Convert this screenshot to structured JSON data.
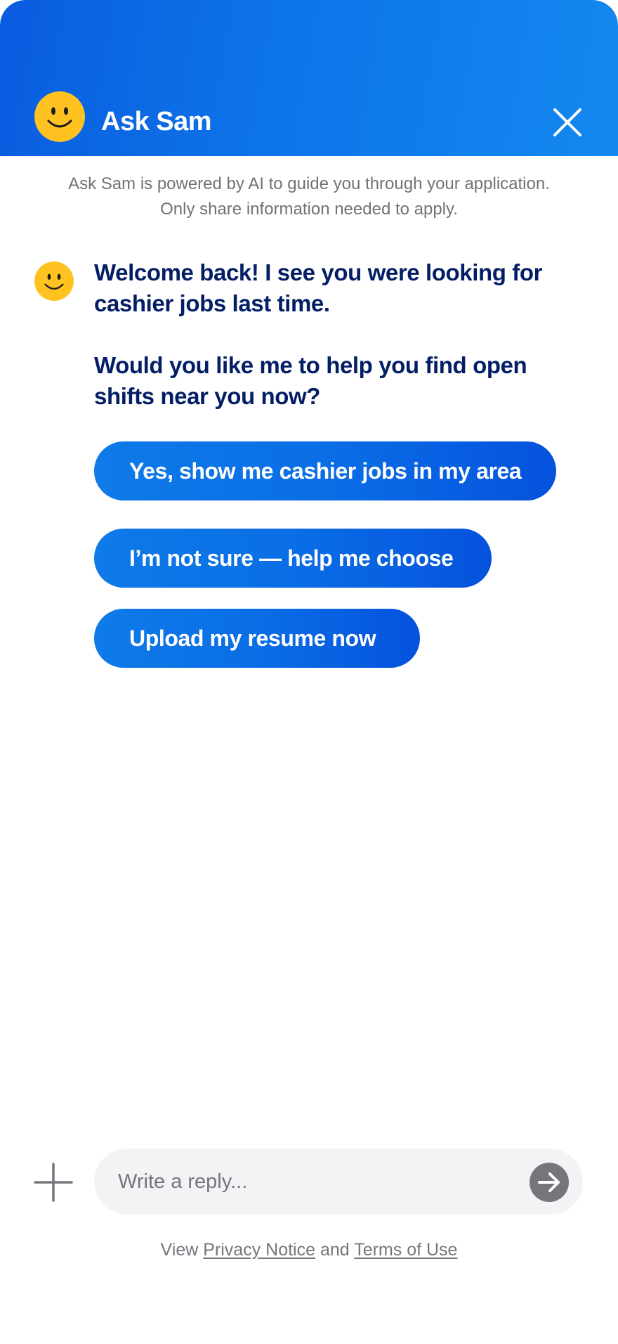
{
  "header": {
    "title": "Ask Sam",
    "avatar_icon": "smiley-face-icon",
    "close_icon": "close-icon",
    "gradient_colors": [
      "#0a5ce0",
      "#1488f0"
    ],
    "avatar_color": "#ffc220"
  },
  "disclaimer": {
    "line1": "Ask Sam is powered by AI to guide you through your application.",
    "line2": "Only share information needed to apply."
  },
  "conversation": {
    "bot_avatar_icon": "smiley-face-icon",
    "message_paragraph1": "Welcome back! I see you were looking for cashier jobs last time.",
    "message_paragraph2": "Would you like me to help you find open shifts near you now?",
    "text_color": "#041e66"
  },
  "quick_replies": [
    {
      "label": "Yes, show me cashier jobs in my area"
    },
    {
      "label": "I’m not sure — help me choose"
    },
    {
      "label": "Upload my resume now"
    }
  ],
  "composer": {
    "attach_icon": "plus-icon",
    "placeholder": "Write a reply...",
    "value": "",
    "send_icon": "arrow-right-icon"
  },
  "footer": {
    "prefix": "View",
    "privacy_link": "Privacy Notice",
    "conjunction": "and",
    "terms_link": "Terms of Use"
  }
}
